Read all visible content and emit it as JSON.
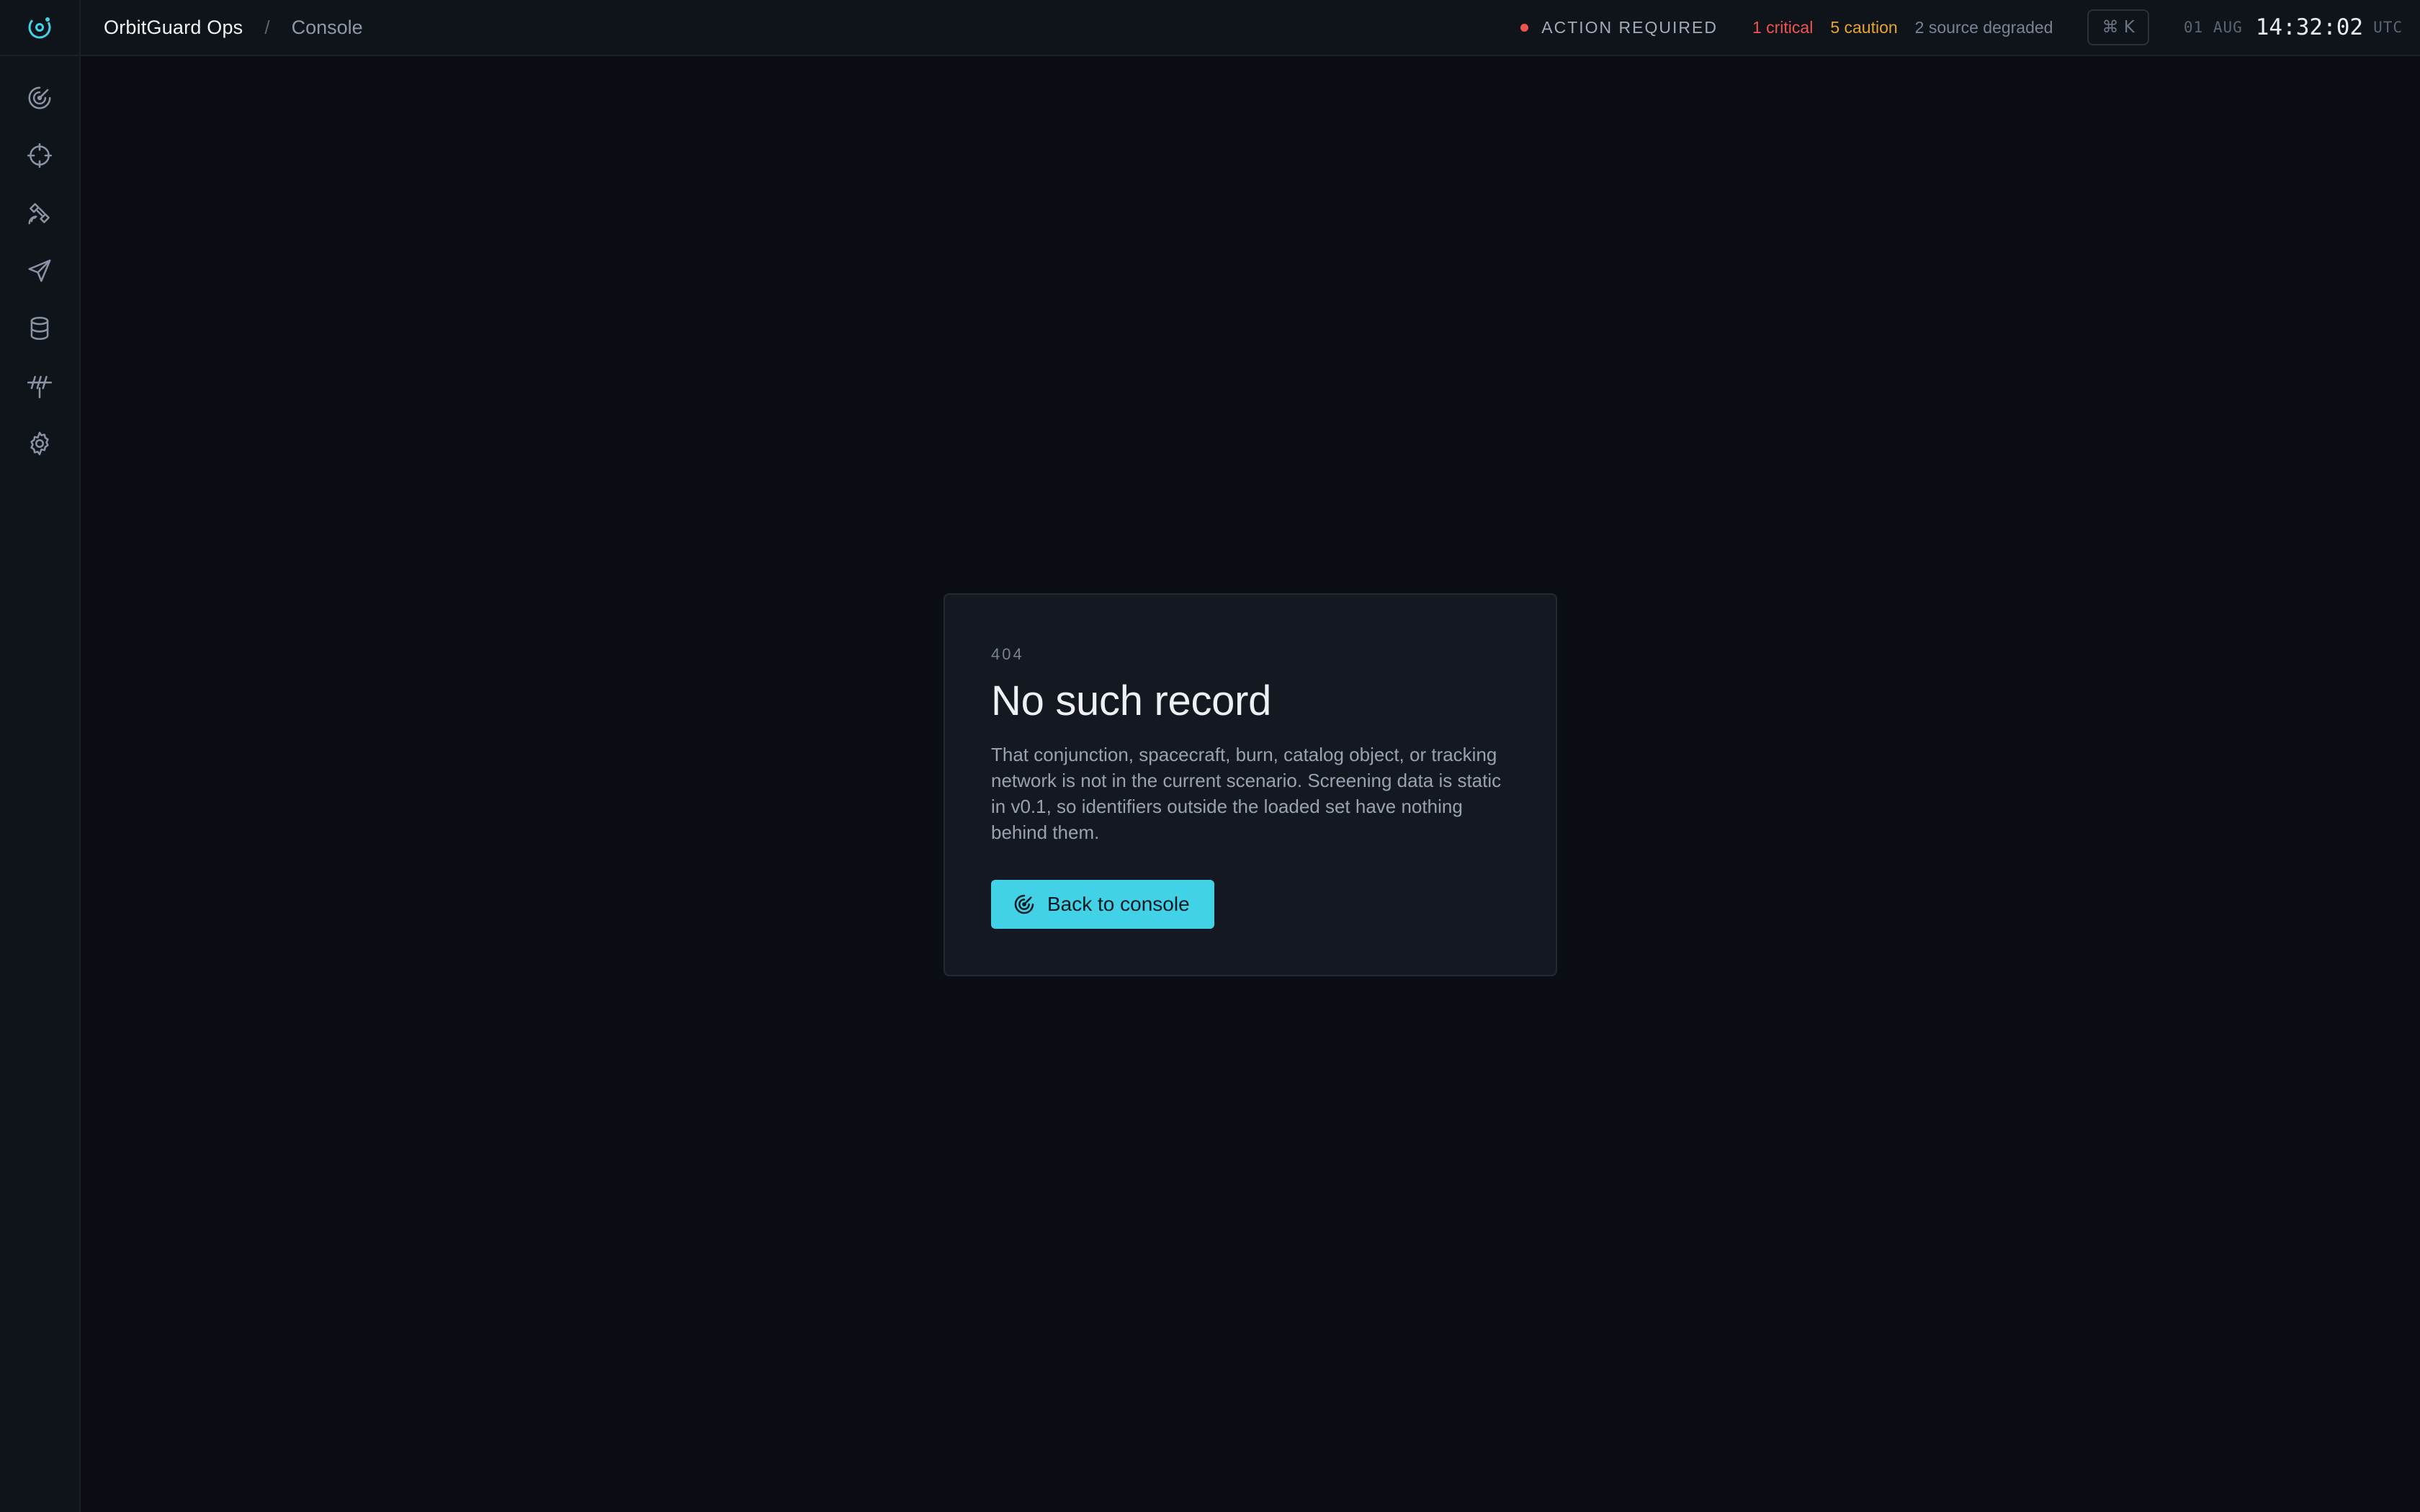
{
  "header": {
    "app_name": "OrbitGuard Ops",
    "separator": "/",
    "page": "Console",
    "alert_label": "ACTION REQUIRED",
    "critical": "1 critical",
    "caution": "5 caution",
    "degraded": "2 source degraded",
    "shortcut": "⌘ K",
    "date": "01 AUG",
    "time": "14:32:02",
    "timezone": "UTC"
  },
  "colors": {
    "accent": "#41d2e8",
    "critical": "#f0544f",
    "caution": "#e6a531",
    "background": "#0a0d14",
    "panel": "#131821"
  },
  "sidebar": {
    "logo_icon": "orbit-logo-icon",
    "items": [
      {
        "icon": "radar-icon"
      },
      {
        "icon": "crosshair-icon"
      },
      {
        "icon": "satellite-icon"
      },
      {
        "icon": "send-icon"
      },
      {
        "icon": "database-icon"
      },
      {
        "icon": "antenna-icon"
      },
      {
        "icon": "gear-icon"
      }
    ]
  },
  "error": {
    "code": "404",
    "title": "No such record",
    "message": "That conjunction, spacecraft, burn, catalog object, or tracking network is not in the current scenario. Screening data is static in v0.1, so identifiers outside the loaded set have nothing behind them.",
    "button_label": "Back to console",
    "button_icon": "radar-icon"
  }
}
